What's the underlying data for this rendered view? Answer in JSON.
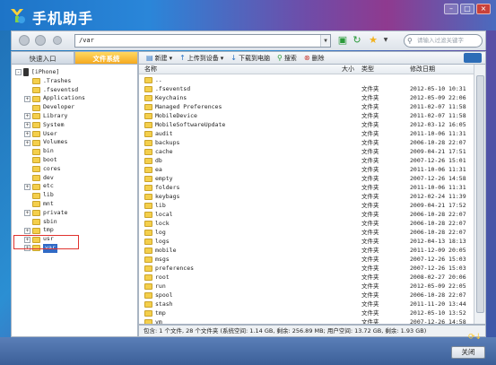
{
  "app": {
    "title": "手机助手"
  },
  "nav": {
    "address": "/var",
    "search_placeholder": "请输入过滤关键字"
  },
  "left_tabs": {
    "quick": "快速入口",
    "files": "文件系统"
  },
  "toolbar": {
    "new": "新建",
    "upload": "上传到设备",
    "download": "下载到电脑",
    "search": "搜索",
    "delete": "删除"
  },
  "tree": [
    {
      "label": "[iPhone]",
      "level": 0,
      "expand": "-",
      "kind": "phone"
    },
    {
      "label": ".Trashes",
      "level": 1,
      "expand": "",
      "kind": "folder"
    },
    {
      "label": ".fseventsd",
      "level": 1,
      "expand": "",
      "kind": "folder"
    },
    {
      "label": "Applications",
      "level": 1,
      "expand": "+",
      "kind": "folder"
    },
    {
      "label": "Developer",
      "level": 1,
      "expand": "",
      "kind": "folder"
    },
    {
      "label": "Library",
      "level": 1,
      "expand": "+",
      "kind": "folder"
    },
    {
      "label": "System",
      "level": 1,
      "expand": "+",
      "kind": "folder"
    },
    {
      "label": "User",
      "level": 1,
      "expand": "+",
      "kind": "folder"
    },
    {
      "label": "Volumes",
      "level": 1,
      "expand": "+",
      "kind": "folder"
    },
    {
      "label": "bin",
      "level": 1,
      "expand": "",
      "kind": "folder"
    },
    {
      "label": "boot",
      "level": 1,
      "expand": "",
      "kind": "folder"
    },
    {
      "label": "cores",
      "level": 1,
      "expand": "",
      "kind": "folder"
    },
    {
      "label": "dev",
      "level": 1,
      "expand": "",
      "kind": "folder"
    },
    {
      "label": "etc",
      "level": 1,
      "expand": "+",
      "kind": "folder"
    },
    {
      "label": "lib",
      "level": 1,
      "expand": "",
      "kind": "folder"
    },
    {
      "label": "mnt",
      "level": 1,
      "expand": "",
      "kind": "folder"
    },
    {
      "label": "private",
      "level": 1,
      "expand": "+",
      "kind": "folder"
    },
    {
      "label": "sbin",
      "level": 1,
      "expand": "",
      "kind": "folder"
    },
    {
      "label": "tmp",
      "level": 1,
      "expand": "+",
      "kind": "folder"
    },
    {
      "label": "usr",
      "level": 1,
      "expand": "+",
      "kind": "folder"
    },
    {
      "label": "var",
      "level": 1,
      "expand": "+",
      "kind": "folder",
      "selected": true
    }
  ],
  "list": {
    "headers": {
      "name": "名称",
      "size": "大小",
      "type": "类型",
      "date": "修改日期"
    },
    "rows": [
      {
        "name": "..",
        "type": "",
        "date": ""
      },
      {
        "name": ".fseventsd",
        "type": "文件夹",
        "date": "2012-05-10 10:31"
      },
      {
        "name": "Keychains",
        "type": "文件夹",
        "date": "2012-05-09 22:06"
      },
      {
        "name": "Managed Preferences",
        "type": "文件夹",
        "date": "2011-02-07 11:58"
      },
      {
        "name": "MobileDevice",
        "type": "文件夹",
        "date": "2011-02-07 11:58"
      },
      {
        "name": "MobileSoftwareUpdate",
        "type": "文件夹",
        "date": "2012-03-12 16:05"
      },
      {
        "name": "audit",
        "type": "文件夹",
        "date": "2011-10-06 11:31"
      },
      {
        "name": "backups",
        "type": "文件夹",
        "date": "2006-10-28 22:07"
      },
      {
        "name": "cache",
        "type": "文件夹",
        "date": "2009-04-21 17:51"
      },
      {
        "name": "db",
        "type": "文件夹",
        "date": "2007-12-26 15:01"
      },
      {
        "name": "ea",
        "type": "文件夹",
        "date": "2011-10-06 11:31"
      },
      {
        "name": "empty",
        "type": "文件夹",
        "date": "2007-12-26 14:58"
      },
      {
        "name": "folders",
        "type": "文件夹",
        "date": "2011-10-06 11:31"
      },
      {
        "name": "keybags",
        "type": "文件夹",
        "date": "2012-02-24 11:39"
      },
      {
        "name": "lib",
        "type": "文件夹",
        "date": "2009-04-21 17:52"
      },
      {
        "name": "local",
        "type": "文件夹",
        "date": "2006-10-28 22:07"
      },
      {
        "name": "lock",
        "type": "文件夹",
        "date": "2006-10-28 22:07"
      },
      {
        "name": "log",
        "type": "文件夹",
        "date": "2006-10-28 22:07"
      },
      {
        "name": "logs",
        "type": "文件夹",
        "date": "2012-04-13 18:13"
      },
      {
        "name": "mobile",
        "type": "文件夹",
        "date": "2011-12-09 20:05"
      },
      {
        "name": "msgs",
        "type": "文件夹",
        "date": "2007-12-26 15:03"
      },
      {
        "name": "preferences",
        "type": "文件夹",
        "date": "2007-12-26 15:03"
      },
      {
        "name": "root",
        "type": "文件夹",
        "date": "2008-02-27 20:06"
      },
      {
        "name": "run",
        "type": "文件夹",
        "date": "2012-05-09 22:05"
      },
      {
        "name": "spool",
        "type": "文件夹",
        "date": "2006-10-28 22:07"
      },
      {
        "name": "stash",
        "type": "文件夹",
        "date": "2011-11-20 13:44"
      },
      {
        "name": "tmp",
        "type": "文件夹",
        "date": "2012-05-10 13:52"
      },
      {
        "name": "vm",
        "type": "文件夹",
        "date": "2007-12-26 14:58"
      }
    ]
  },
  "status": "包含: 1 个文件, 28 个文件夹  (系统空间: 1.14 GB, 剩余: 256.89 MB; 用户空间: 13.72 GB, 剩余: 1.93 GB)",
  "footer": {
    "close": "关闭"
  },
  "colors": {
    "accent": "#316ac5",
    "tab_active": "#f5a91f",
    "highlight": "#e0332f"
  }
}
